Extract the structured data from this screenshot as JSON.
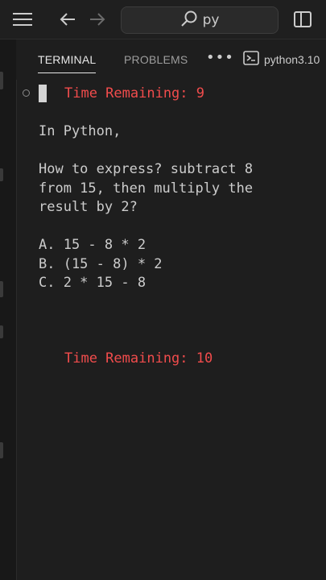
{
  "titlebar": {
    "menu_icon": "hamburger-menu-icon",
    "back_icon": "arrow-left-icon",
    "forward_icon": "arrow-right-icon",
    "search_text": "py",
    "layout_icon": "split-panel-icon"
  },
  "panel": {
    "tabs": [
      {
        "label": "TERMINAL",
        "active": true
      },
      {
        "label": "PROBLEMS",
        "active": false
      }
    ],
    "more": "•••",
    "terminal_name": "python3.10"
  },
  "terminal": {
    "timer_top": "Time Remaining: 9",
    "line1": "In Python,",
    "question_1": "How to express? subtract 8",
    "question_2": "from 15, then multiply the",
    "question_3": "result by 2?",
    "option_a": "A. 15 - 8 * 2",
    "option_b": "B. (15 - 8) * 2",
    "option_c": "C. 2 * 15 - 8",
    "timer_bottom": "Time Remaining: 10"
  },
  "colors": {
    "background": "#1e1e1e",
    "timer_red": "#f14c4c",
    "text": "#cccccc"
  }
}
